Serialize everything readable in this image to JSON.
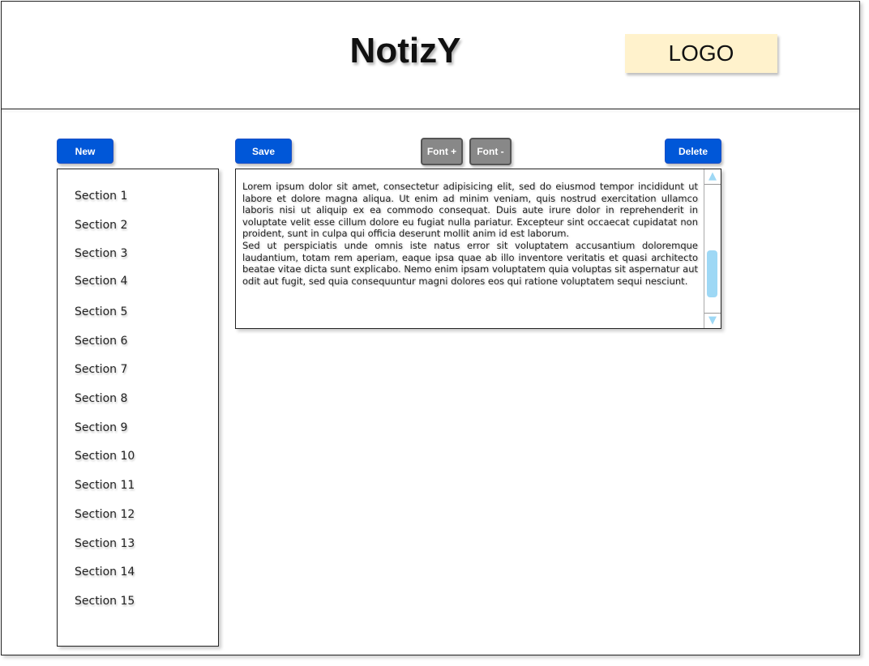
{
  "header": {
    "title": "NotizY",
    "logo_label": "LOGO"
  },
  "toolbar": {
    "new_label": "New",
    "save_label": "Save",
    "font_increase_label": "Font +",
    "font_decrease_label": "Font -",
    "delete_label": "Delete"
  },
  "sidebar": {
    "items": [
      {
        "label": "Section 1"
      },
      {
        "label": "Section 2"
      },
      {
        "label": "Section 3"
      },
      {
        "label": "Section 4"
      },
      {
        "label": "Section 5"
      },
      {
        "label": "Section 6"
      },
      {
        "label": "Section 7"
      },
      {
        "label": "Section 8"
      },
      {
        "label": "Section 9"
      },
      {
        "label": "Section 10"
      },
      {
        "label": "Section 11"
      },
      {
        "label": "Section 12"
      },
      {
        "label": "Section 13"
      },
      {
        "label": "Section 14"
      },
      {
        "label": "Section 15"
      }
    ]
  },
  "editor": {
    "paragraphs": [
      "Lorem ipsum dolor sit amet, consectetur adipisicing elit, sed do eiusmod tempor incididunt ut labore et dolore magna aliqua. Ut enim ad minim veniam, quis nostrud exercitation ullamco laboris nisi ut aliquip ex ea commodo consequat. Duis aute irure dolor in reprehenderit in voluptate velit esse cillum dolore eu fugiat nulla pariatur. Excepteur sint occaecat cupidatat non proident, sunt in culpa qui officia deserunt mollit anim id est laborum.",
      "Sed ut perspiciatis unde omnis iste natus error sit voluptatem accusantium doloremque laudantium, totam rem aperiam, eaque ipsa quae ab illo inventore veritatis et quasi architecto beatae vitae dicta sunt explicabo. Nemo enim ipsam voluptatem quia voluptas sit aspernatur aut odit aut fugit, sed quia consequuntur magni dolores eos qui ratione voluptatem sequi nesciunt."
    ]
  },
  "colors": {
    "primary_button": "#0057d8",
    "secondary_button": "#888888",
    "logo_background": "#fff2cc",
    "scrollbar_accent": "#9ed8f5"
  },
  "icons": {
    "scroll_up": "triangle-up",
    "scroll_down": "triangle-down"
  }
}
